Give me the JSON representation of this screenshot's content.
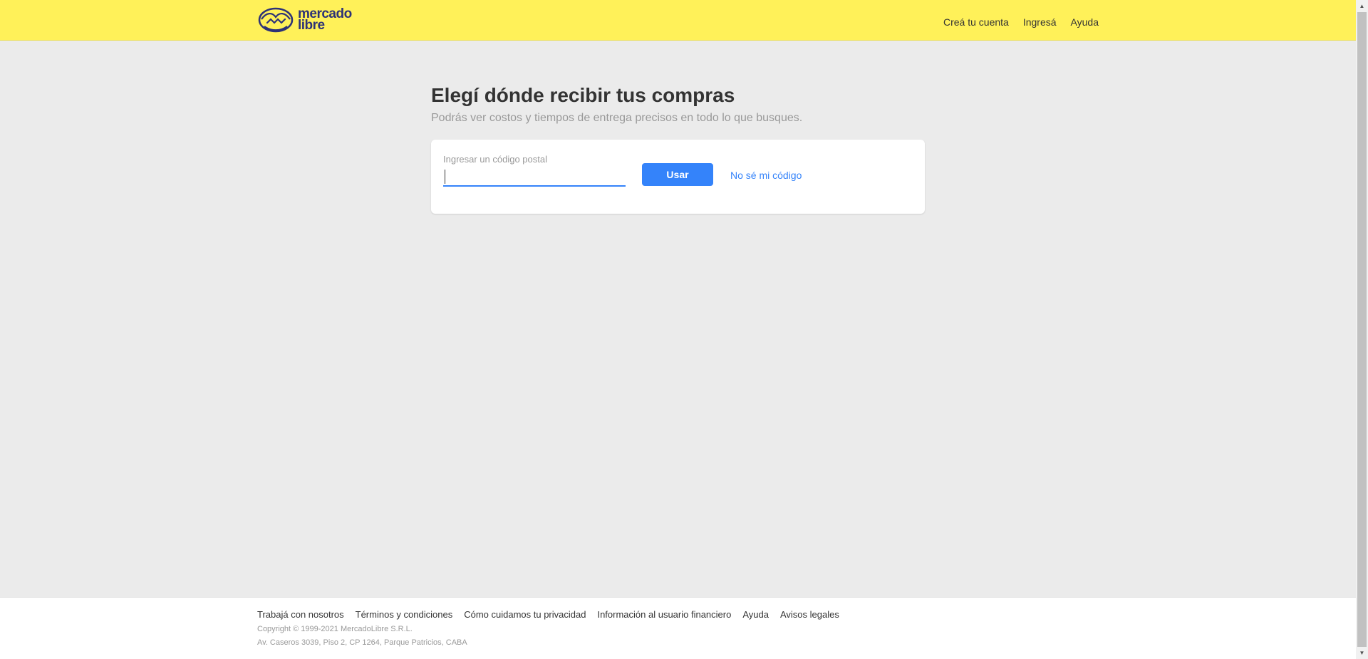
{
  "header": {
    "logo": {
      "line1": "mercado",
      "line2": "libre"
    },
    "nav": [
      {
        "label": "Creá tu cuenta"
      },
      {
        "label": "Ingresá"
      },
      {
        "label": "Ayuda"
      }
    ]
  },
  "main": {
    "title": "Elegí dónde recibir tus compras",
    "subtitle": "Podrás ver costos y tiempos de entrega precisos en todo lo que busques.",
    "postal_form": {
      "label": "Ingresar un código postal",
      "value": "",
      "button_label": "Usar",
      "help_link": "No sé mi código"
    }
  },
  "footer": {
    "links": [
      {
        "label": "Trabajá con nosotros"
      },
      {
        "label": "Términos y condiciones"
      },
      {
        "label": "Cómo cuidamos tu privacidad"
      },
      {
        "label": "Información al usuario financiero"
      },
      {
        "label": "Ayuda"
      },
      {
        "label": "Avisos legales"
      }
    ],
    "copyright": "Copyright © 1999-2021 MercadoLibre S.R.L.",
    "address": "Av. Caseros 3039, Piso 2, CP 1264, Parque Patricios, CABA"
  },
  "colors": {
    "header_bg": "#fff159",
    "accent": "#3483fa",
    "page_bg": "#ebebeb"
  },
  "icons": {
    "logo": "handshake-logo-icon",
    "scroll_up": "scroll-up-icon",
    "scroll_down": "scroll-down-icon"
  }
}
